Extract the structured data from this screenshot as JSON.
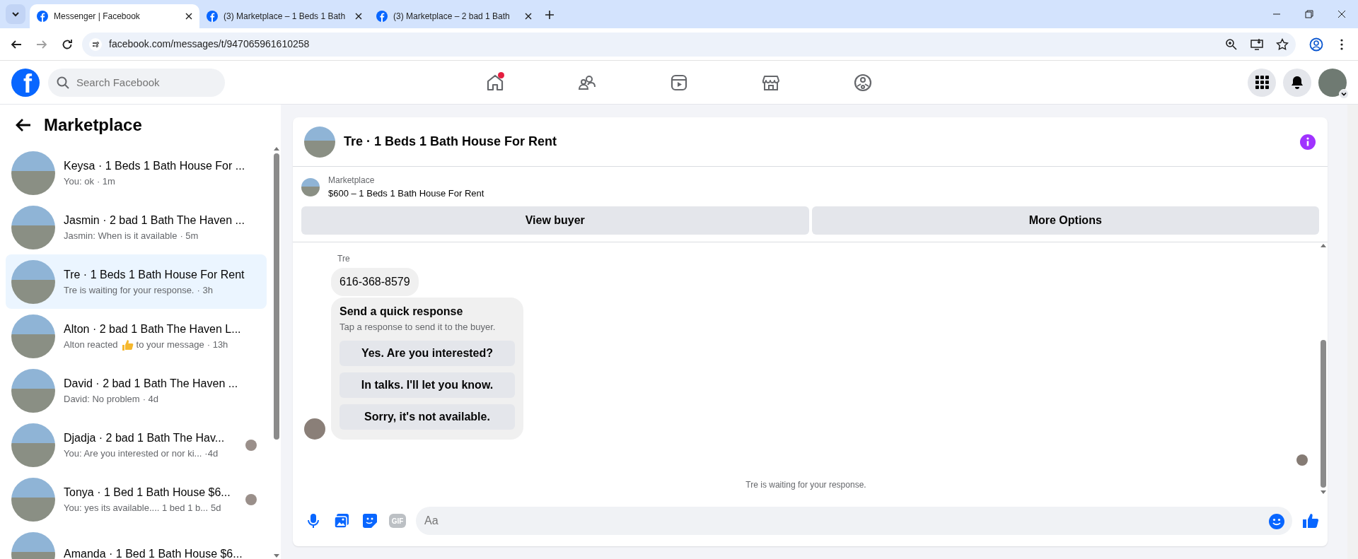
{
  "browser": {
    "tabs": [
      {
        "title": "Messenger | Facebook",
        "selected": true
      },
      {
        "title": "(3) Marketplace – 1 Beds 1 Bath",
        "selected": false
      },
      {
        "title": "(3) Marketplace – 2 bad 1 Bath",
        "selected": false
      }
    ],
    "url": "facebook.com/messages/t/947065961610258"
  },
  "header": {
    "logo": "f",
    "search": {
      "placeholder": "Search Facebook"
    },
    "nav": [
      {
        "kind": "home",
        "badge": true
      },
      {
        "kind": "friends",
        "badge": false
      },
      {
        "kind": "video",
        "badge": false
      },
      {
        "kind": "marketplace",
        "badge": false
      },
      {
        "kind": "gaming",
        "badge": false
      }
    ]
  },
  "sidebar": {
    "title": "Marketplace",
    "items": [
      {
        "title": "Keysa · 1 Beds 1 Bath House For ...",
        "preview": "You: ok",
        "time": "· 1m",
        "seen": false,
        "selected": false
      },
      {
        "title": "Jasmin · 2 bad 1 Bath The Haven ...",
        "preview": "Jasmin: When is it available",
        "time": "· 5m",
        "seen": false,
        "selected": false
      },
      {
        "title": "Tre · 1 Beds 1 Bath House For Rent",
        "preview": "Tre is waiting for your response.",
        "time": "· 3h",
        "seen": false,
        "selected": true
      },
      {
        "title": "Alton · 2 bad 1 Bath The Haven L...",
        "preview": "Alton reacted",
        "reaction": true,
        "preview_end": "to your message",
        "time": "· 13h",
        "seen": false,
        "selected": false
      },
      {
        "title": "David · 2 bad 1 Bath The Haven ...",
        "preview": "David: No problem",
        "time": "· 4d",
        "seen": false,
        "selected": false
      },
      {
        "title": "Djadja · 2 bad 1 Bath The Hav...",
        "preview": "You: Are you interested or nor ki...",
        "time": "·4d",
        "seen": true,
        "selected": false
      },
      {
        "title": "Tonya · 1 Bed 1 Bath House $6...",
        "preview": "You: yes its available.... 1 bed 1 b...",
        "time": "5d",
        "seen": true,
        "selected": false
      },
      {
        "title": "Amanda · 1 Bed 1 Bath House $6...",
        "seen": false,
        "selected": false
      }
    ]
  },
  "chat": {
    "title": "Tre · 1 Beds 1 Bath House For Rent",
    "listing": {
      "label": "Marketplace",
      "text": "$600 – 1 Beds 1 Bath House For Rent"
    },
    "actions": [
      "View buyer",
      "More Options"
    ],
    "sender": "Tre",
    "message": "616-368-8579",
    "quick": {
      "title": "Send a quick response",
      "subtitle": "Tap a response to send it to the buyer.",
      "options": [
        "Yes. Are you interested?",
        "In talks. I'll let you know.",
        "Sorry, it's not available."
      ]
    },
    "status": "Tre is waiting for your response.",
    "composer": {
      "tools": [
        {
          "kind": "mic"
        },
        {
          "kind": "photo"
        },
        {
          "kind": "sticker"
        },
        {
          "kind": "gif",
          "text": "GIF"
        }
      ],
      "placeholder": "Aa"
    }
  }
}
